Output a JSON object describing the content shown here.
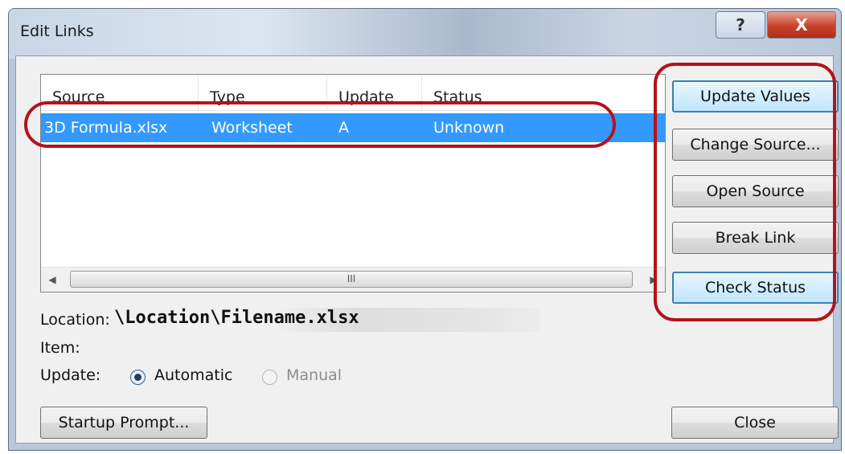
{
  "window": {
    "title": "Edit Links",
    "help_glyph": "?",
    "close_glyph": "X"
  },
  "links_table": {
    "columns": [
      "Source",
      "Type",
      "Update",
      "Status"
    ],
    "rows": [
      {
        "source": "3D Formula.xlsx",
        "type": "Worksheet",
        "update": "A",
        "status": "Unknown"
      }
    ],
    "scroll_left": "◀",
    "scroll_right": "▶",
    "scroll_grip": "III"
  },
  "buttons": {
    "update_values": "Update Values",
    "change_source": "Change Source...",
    "open_source": "Open Source",
    "break_link": "Break Link",
    "check_status": "Check Status",
    "startup_prompt": "Startup Prompt...",
    "close": "Close"
  },
  "details": {
    "location_label": "Location:",
    "location_value": "\\Location\\Filename.xlsx",
    "item_label": "Item:",
    "update_label": "Update:",
    "automatic": "Automatic",
    "manual": "Manual",
    "selected_update_mode": "Automatic"
  },
  "colors": {
    "selection": "#3399ff",
    "annotation": "#b5121b",
    "default_button": "#bee6fd"
  }
}
